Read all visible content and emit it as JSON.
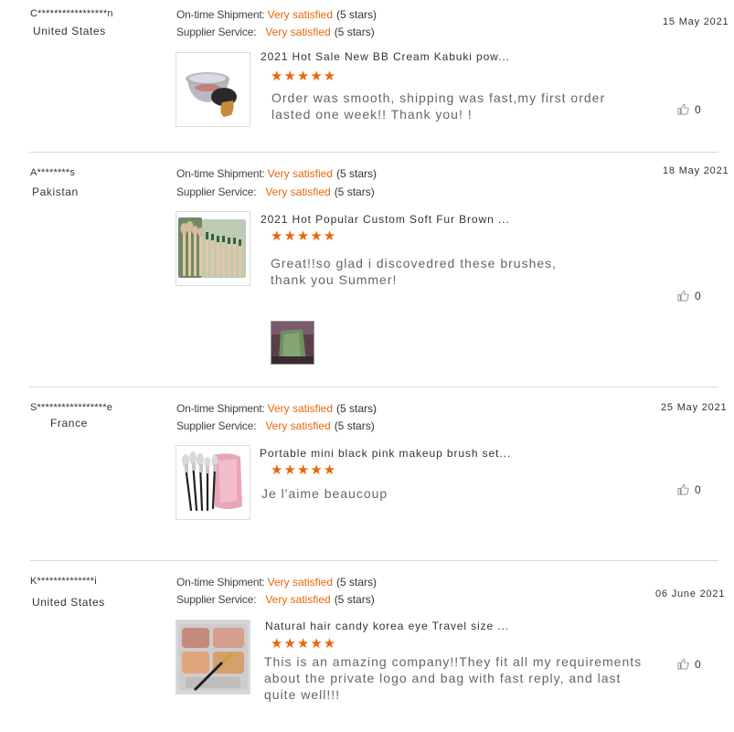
{
  "labels": {
    "shipment": "On-time Shipment:",
    "supplier": "Supplier Service:"
  },
  "colors": {
    "accent": "#e9660c",
    "divider": "#d9d9d9"
  },
  "reviews": [
    {
      "buyer": "C*****************n",
      "country": "United States",
      "shipment_rating": "Very satisfied",
      "shipment_stars": "(5 stars)",
      "supplier_rating": "Very satisfied",
      "supplier_stars": "(5 stars)",
      "date": "15 May 2021",
      "product_title": "2021 Hot Sale New BB Cream Kabuki pow...",
      "stars": "★★★★★",
      "rating": 5,
      "comment": "Order was smooth, shipping was fast,my first order lasted one week!! Thank you! !",
      "likes": "0"
    },
    {
      "buyer": "A********s",
      "country": "Pakistan",
      "shipment_rating": "Very satisfied",
      "shipment_stars": "(5 stars)",
      "supplier_rating": "Very satisfied",
      "supplier_stars": "(5 stars)",
      "date": "18 May 2021",
      "product_title": "2021 Hot Popular Custom Soft Fur Brown ...",
      "stars": "★★★★★",
      "rating": 5,
      "comment": "Great!!so glad i discovedred these brushes, thank you Summer!",
      "likes": "0"
    },
    {
      "buyer": "S*****************e",
      "country": "France",
      "shipment_rating": "Very satisfied",
      "shipment_stars": "(5 stars)",
      "supplier_rating": "Very satisfied",
      "supplier_stars": "(5 stars)",
      "date": "25 May 2021",
      "product_title": "Portable mini black pink makeup brush set...",
      "stars": "★★★★★",
      "rating": 5,
      "comment": "Je l'aime beaucoup",
      "likes": "0"
    },
    {
      "buyer": "K**************i",
      "country": "United States",
      "shipment_rating": "Very satisfied",
      "shipment_stars": "(5 stars)",
      "supplier_rating": "Very satisfied",
      "supplier_stars": "(5 stars)",
      "date": "06 June 2021",
      "product_title": "Natural hair candy korea eye Travel size ...",
      "stars": "★★★★★",
      "rating": 5,
      "comment": "This is an amazing company!!They fit all my requirements about the private logo and bag with fast reply, and last quite well!!!",
      "likes": "0"
    }
  ]
}
